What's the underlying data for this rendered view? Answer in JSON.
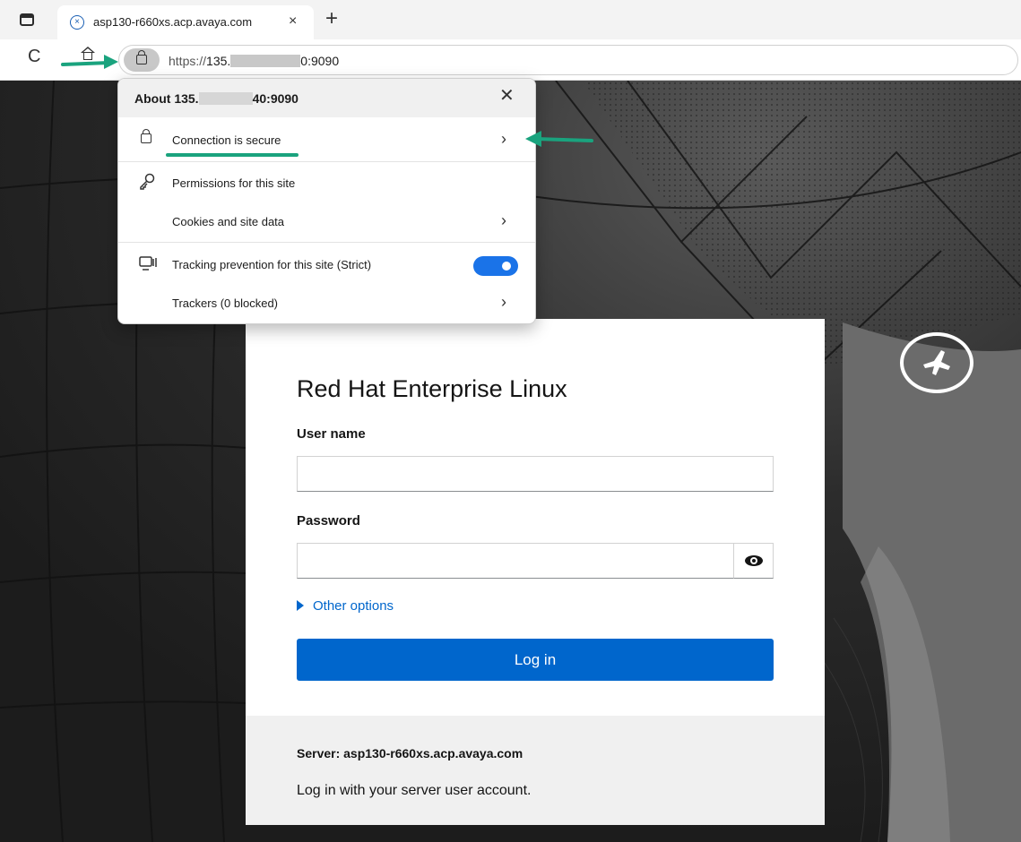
{
  "browser": {
    "tab": {
      "title": "asp130-r660xs.acp.avaya.com",
      "favicon_glyph": "×",
      "close_glyph": "×"
    },
    "new_tab_glyph": "+",
    "refresh_glyph": "C",
    "address": {
      "scheme": "https://",
      "host_prefix": "135.",
      "host_suffix": "0:9090"
    }
  },
  "site_info": {
    "title_prefix": "About 135.",
    "title_suffix": "40:9090",
    "close_glyph": "✕",
    "rows": [
      {
        "label": "Connection is secure",
        "chevron": "›"
      },
      {
        "label": "Permissions for this site"
      },
      {
        "label": "Cookies and site data",
        "chevron": "›"
      },
      {
        "label": "Tracking prevention for this site (Strict)",
        "toggle_on": true
      },
      {
        "label": "Trackers (0 blocked)",
        "chevron": "›"
      }
    ]
  },
  "login": {
    "title": "Red Hat Enterprise Linux",
    "username_label": "User name",
    "username_value": "",
    "password_label": "Password",
    "password_value": "",
    "other_options": "Other options",
    "login_button": "Log in",
    "server": "Server: asp130-r660xs.acp.avaya.com",
    "message": "Log in with your server user account."
  },
  "colors": {
    "accent_blue": "#0066cc",
    "annotation_green": "#1aa37e",
    "toggle_blue": "#1a73e8"
  }
}
